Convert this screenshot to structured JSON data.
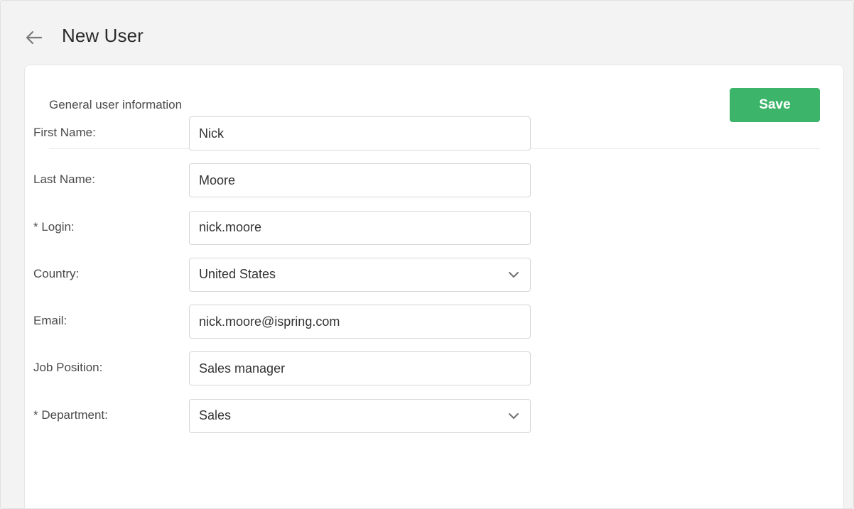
{
  "header": {
    "back_icon": "arrow-left-icon",
    "title": "New User"
  },
  "card": {
    "section_title": "General user information",
    "save_label": "Save"
  },
  "form": {
    "first_name": {
      "label": "First Name:",
      "value": "Nick"
    },
    "last_name": {
      "label": "Last Name:",
      "value": "Moore"
    },
    "login": {
      "label": "* Login:",
      "value": "nick.moore"
    },
    "country": {
      "label": "Country:",
      "value": "United States",
      "icon": "chevron-down-icon"
    },
    "email": {
      "label": "Email:",
      "value": "nick.moore@ispring.com"
    },
    "job_position": {
      "label": "Job Position:",
      "value": "Sales manager"
    },
    "department": {
      "label": "* Department:",
      "value": "Sales",
      "icon": "chevron-down-icon"
    }
  },
  "colors": {
    "accent": "#3cb56a",
    "background": "#f3f3f3",
    "card": "#ffffff"
  }
}
